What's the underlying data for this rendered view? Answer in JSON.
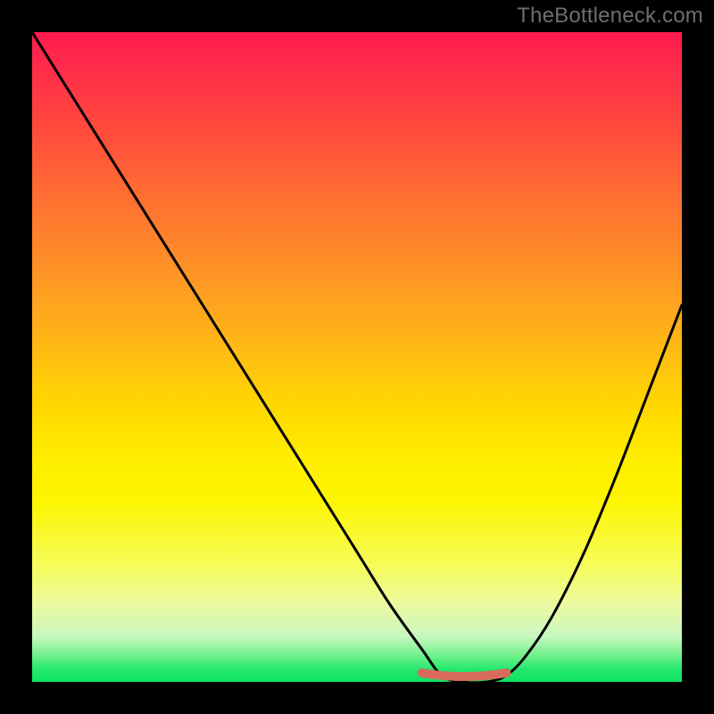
{
  "watermark": "TheBottleneck.com",
  "colors": {
    "frame": "#000000",
    "watermark_text": "#6e6e6e",
    "curve_stroke": "#000000",
    "compatibility_marker": "#d96a5c"
  },
  "chart_data": {
    "type": "line",
    "title": "",
    "xlabel": "",
    "ylabel": "",
    "xlim": [
      0,
      100
    ],
    "ylim": [
      0,
      100
    ],
    "gradient_bands": [
      {
        "color": "#ff1a4d",
        "meaning": "severe-bottleneck"
      },
      {
        "color": "#ffd900",
        "meaning": "moderate-bottleneck"
      },
      {
        "color": "#0de25f",
        "meaning": "no-bottleneck"
      }
    ],
    "series": [
      {
        "name": "bottleneck-curve",
        "x": [
          0,
          5,
          10,
          15,
          20,
          25,
          30,
          35,
          40,
          45,
          50,
          55,
          60,
          63,
          66,
          70,
          73,
          76,
          80,
          85,
          90,
          95,
          100
        ],
        "values": [
          100,
          92,
          84,
          76,
          68,
          60,
          52,
          44,
          36,
          28,
          20,
          12,
          5,
          1,
          0,
          0,
          1,
          4,
          10,
          20,
          32,
          45,
          58
        ]
      }
    ],
    "compatibility_range": {
      "x_start": 60,
      "x_end": 73,
      "value": 0
    }
  }
}
